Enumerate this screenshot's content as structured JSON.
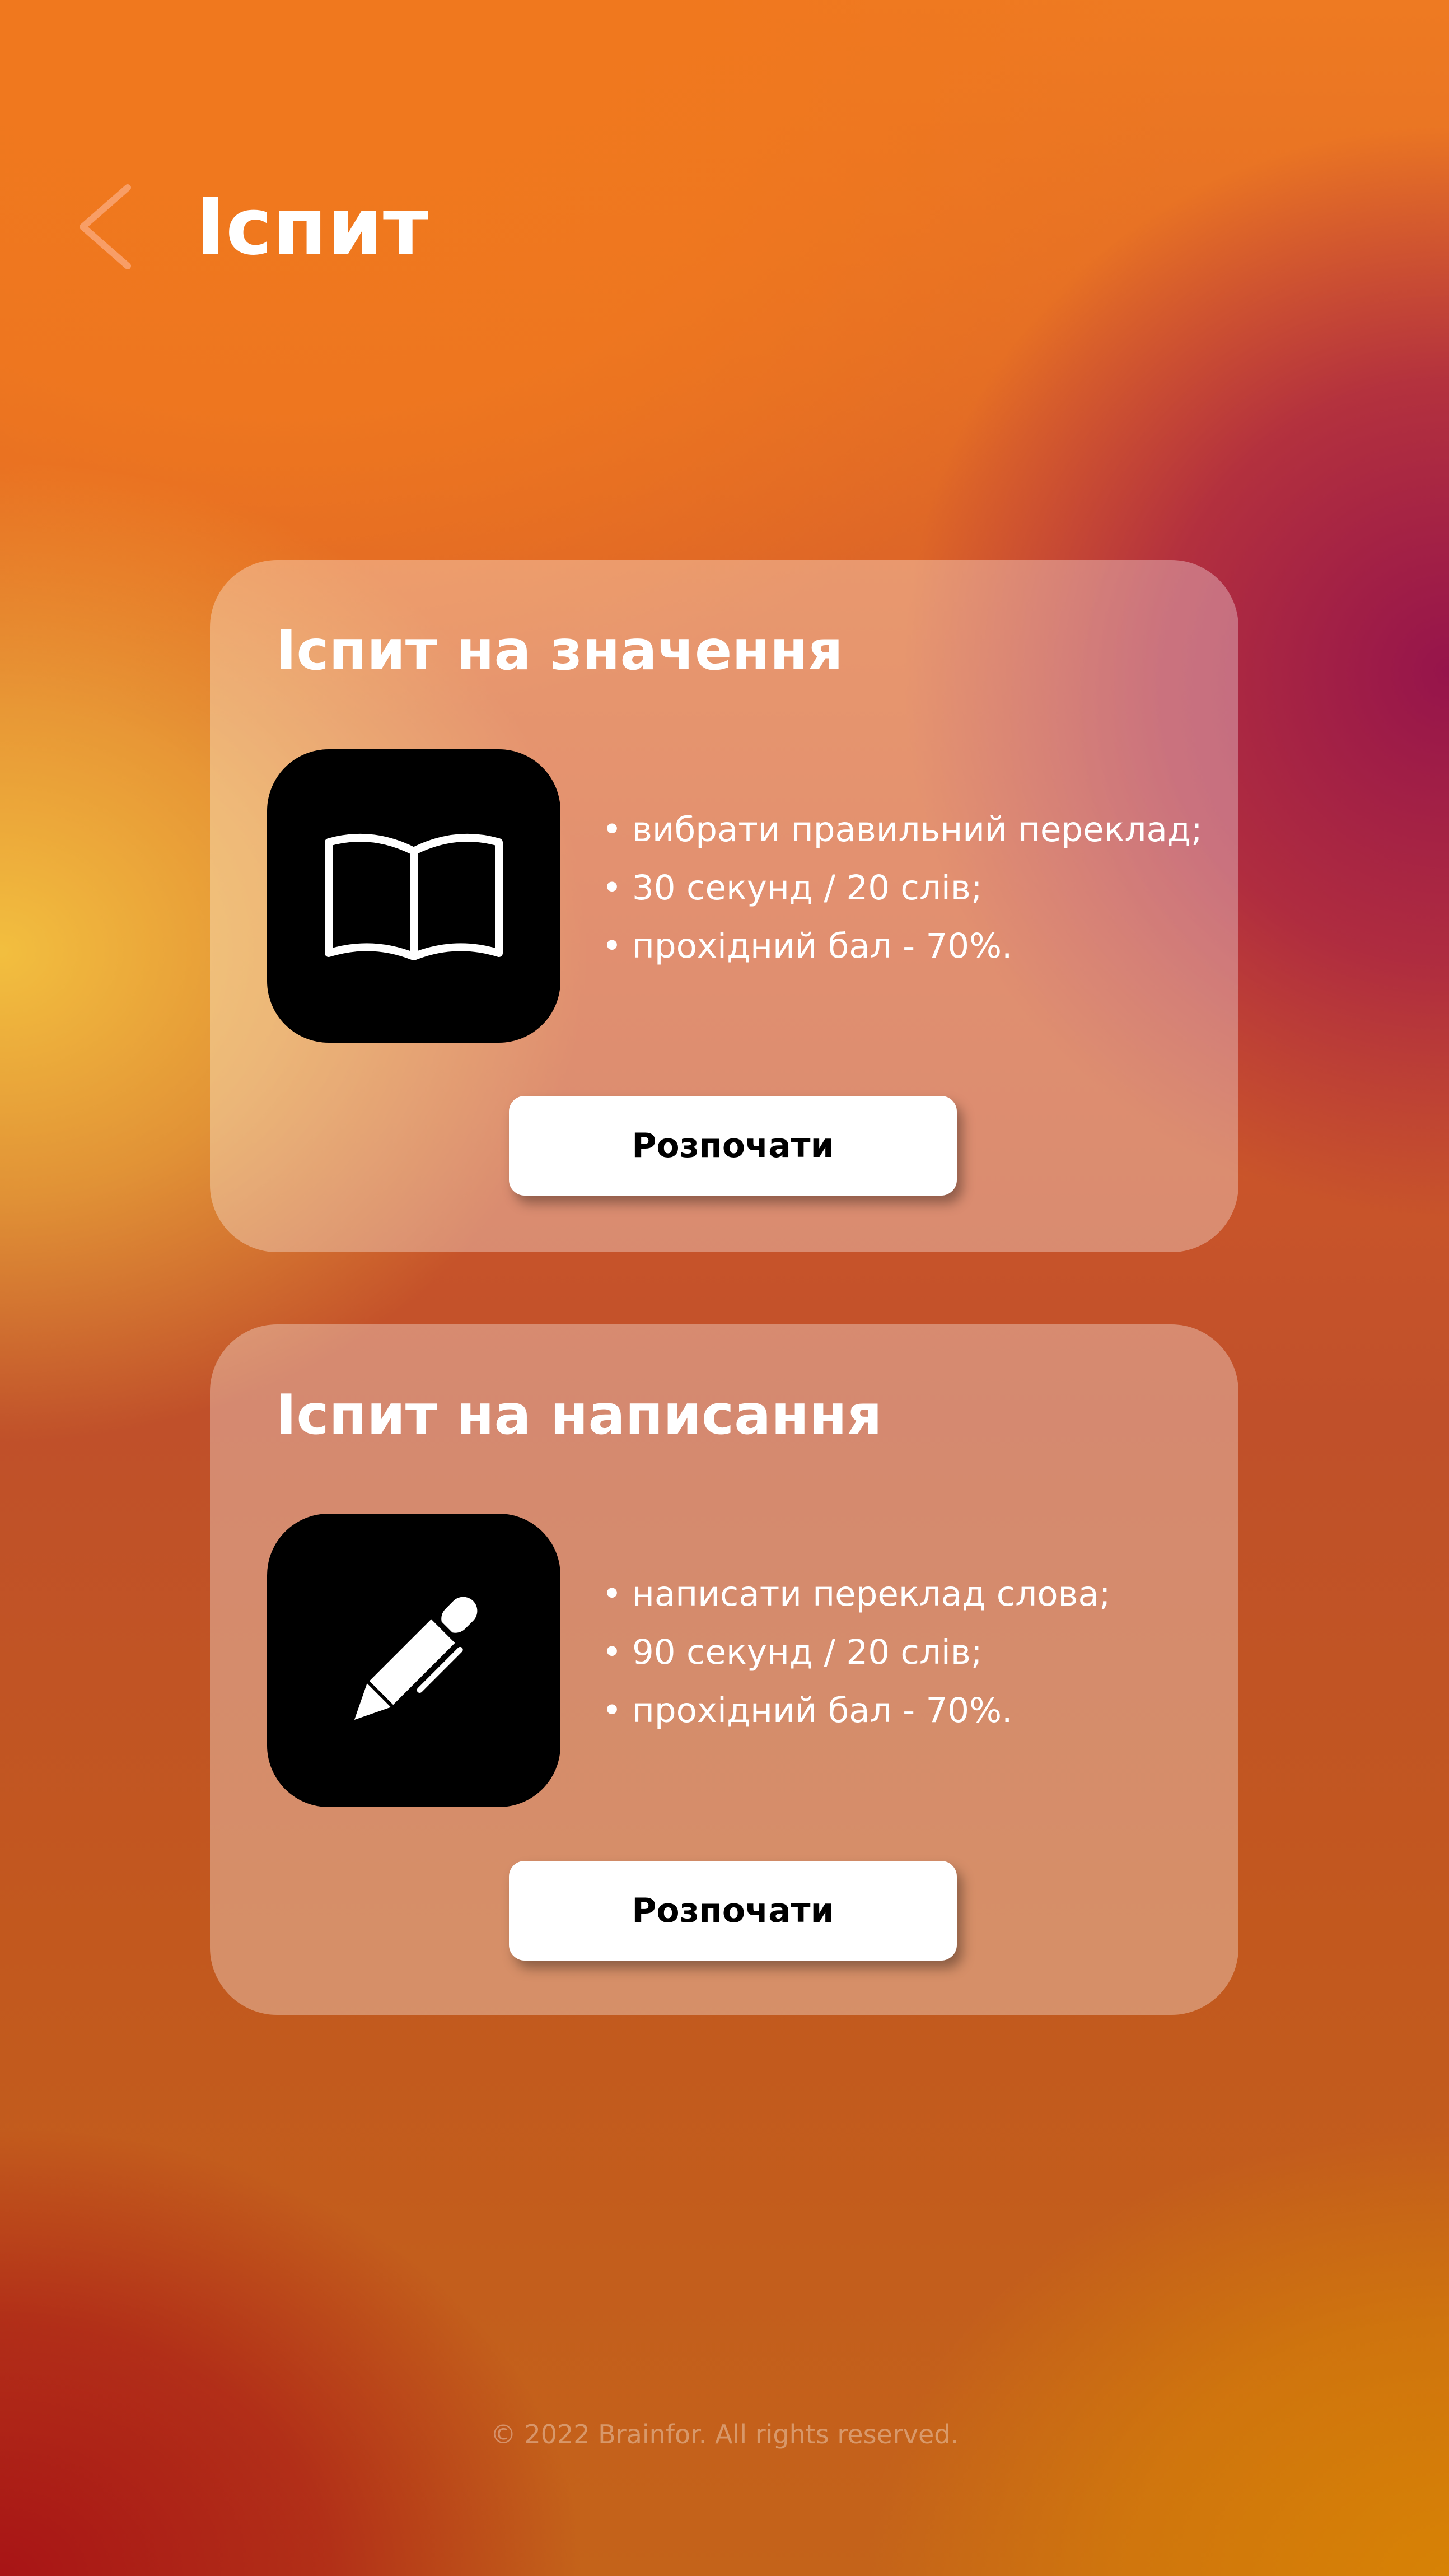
{
  "header": {
    "back_icon": "chevron-left-icon",
    "title": "Іспит"
  },
  "cards": [
    {
      "title": "Іспит на значення",
      "icon": "open-book-icon",
      "bullets": [
        "вибрати правильний переклад;",
        "30 секунд / 20 слів;",
        "прохідний бал - 70%."
      ],
      "button_label": "Розпочати"
    },
    {
      "title": "Іспит на написання",
      "icon": "pen-icon",
      "bullets": [
        "написати переклад слова;",
        "90 секунд / 20 слів;",
        "прохідний бал - 70%."
      ],
      "button_label": "Розпочати"
    }
  ],
  "footer": {
    "copyright": "© 2022 Brainfor. All rights reserved."
  },
  "colors": {
    "card_background": "rgba(255,255,255,0.33)",
    "icon_tile": "#000000",
    "button_background": "#ffffff",
    "text_primary": "#ffffff"
  }
}
